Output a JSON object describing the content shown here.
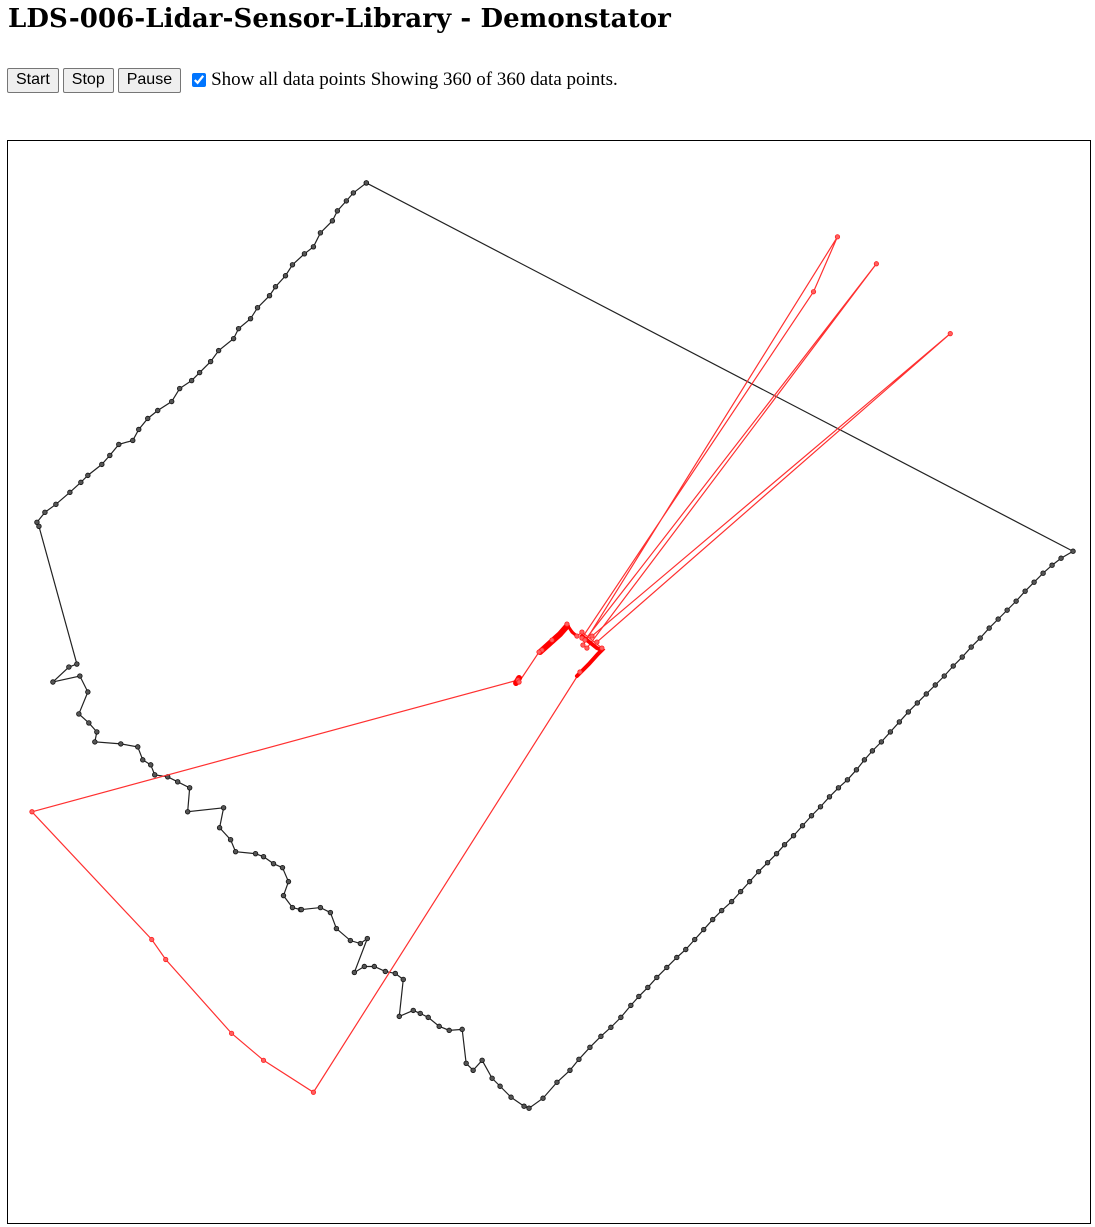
{
  "page": {
    "title": "LDS-006-Lidar-Sensor-Library - Demonstator"
  },
  "controls": {
    "start_label": "Start",
    "stop_label": "Stop",
    "pause_label": "Pause",
    "show_all_label": "Show all data points",
    "show_all_checked": true,
    "count_text": "Showing 360 of 360 data points."
  },
  "colors": {
    "valid_points": "#222222",
    "invalid_points": "#ff0000",
    "accent": "#0075ff"
  }
}
